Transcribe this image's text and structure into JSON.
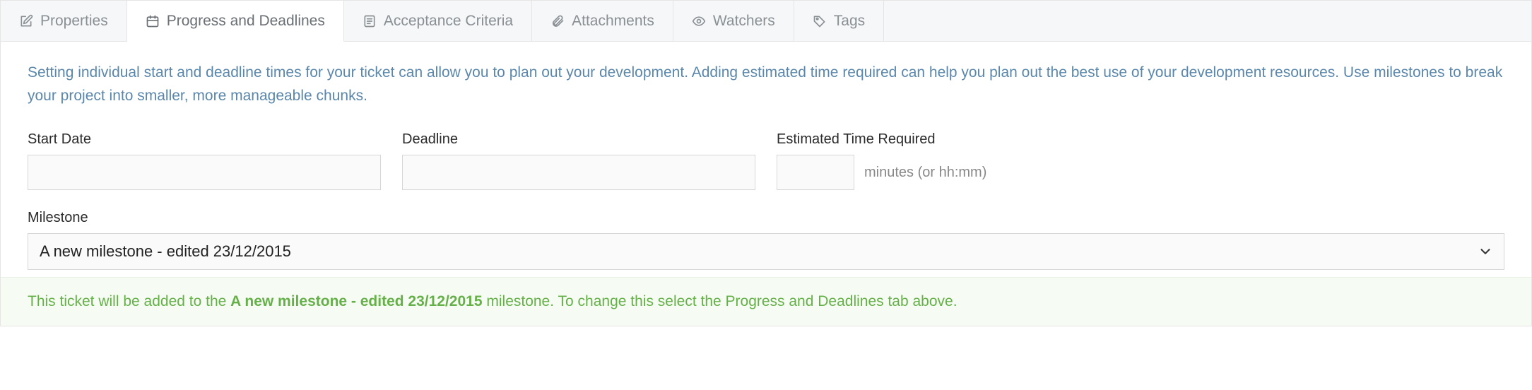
{
  "tabs": {
    "properties": {
      "label": "Properties"
    },
    "progress": {
      "label": "Progress and Deadlines"
    },
    "acceptance": {
      "label": "Acceptance Criteria"
    },
    "attachments": {
      "label": "Attachments"
    },
    "watchers": {
      "label": "Watchers"
    },
    "tags": {
      "label": "Tags"
    },
    "active": "progress"
  },
  "help_text": "Setting individual start and deadline times for your ticket can allow you to plan out your development. Adding estimated time required can help you plan out the best use of your development resources. Use milestones to break your project into smaller, more manageable chunks.",
  "fields": {
    "start_date": {
      "label": "Start Date",
      "value": ""
    },
    "deadline": {
      "label": "Deadline",
      "value": ""
    },
    "estimated": {
      "label": "Estimated Time Required",
      "value": "",
      "hint": "minutes (or hh:mm)"
    },
    "milestone": {
      "label": "Milestone",
      "value": "A new milestone - edited 23/12/2015"
    }
  },
  "footer": {
    "prefix": "This ticket will be added to the ",
    "milestone_name": "A new milestone - edited 23/12/2015",
    "suffix": " milestone. To change this select the Progress and Deadlines tab above."
  },
  "colors": {
    "accent_link": "#5a87ab",
    "success_text": "#66b04a",
    "success_bg": "#f6fcf3"
  }
}
